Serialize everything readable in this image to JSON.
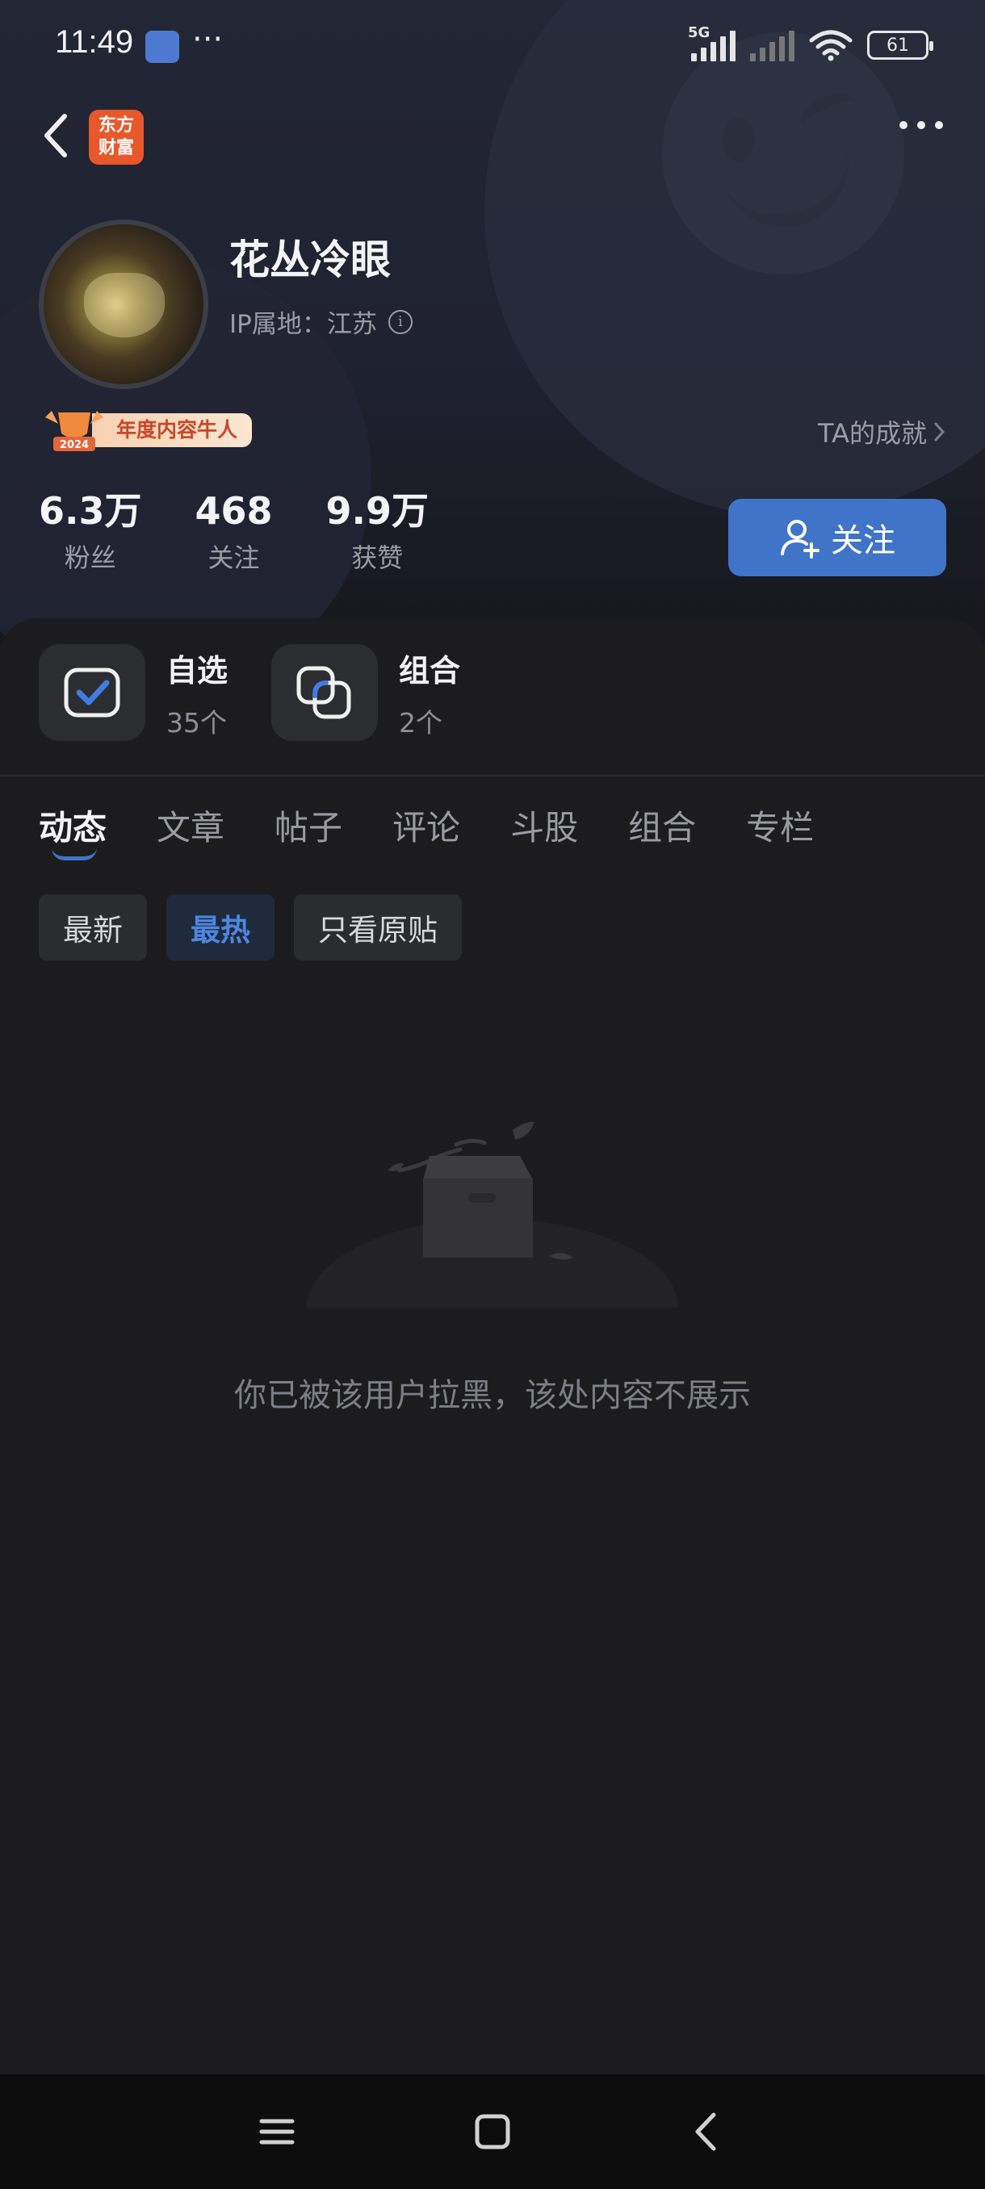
{
  "status_bar": {
    "time": "11:49",
    "more_dots": "···",
    "network": "5G",
    "battery": "61"
  },
  "nav": {
    "brand_logo_text": "东方财富",
    "brand_color": "#e8582a"
  },
  "profile": {
    "username": "花丛冷眼",
    "ip_location": "IP属地：江苏",
    "badge_year": "2024",
    "badge_label": "年度内容牛人",
    "achievements_link": "TA的成就"
  },
  "stats": [
    {
      "value": "6.3万",
      "label": "粉丝"
    },
    {
      "value": "468",
      "label": "关注"
    },
    {
      "value": "9.9万",
      "label": "获赞"
    }
  ],
  "follow_button": {
    "label": "关注",
    "color": "#3f74c9"
  },
  "quick_links": [
    {
      "title": "自选",
      "count": "35个",
      "icon": "checked-box-icon"
    },
    {
      "title": "组合",
      "count": "2个",
      "icon": "overlapping-squares-icon"
    }
  ],
  "tabs": [
    "动态",
    "文章",
    "帖子",
    "评论",
    "斗股",
    "组合",
    "专栏"
  ],
  "active_tab": "动态",
  "filters": [
    "最新",
    "最热",
    "只看原贴"
  ],
  "active_filter": "最热",
  "empty_state": {
    "message": "你已被该用户拉黑，该处内容不展示",
    "icon": "empty-box-icon"
  },
  "system_nav": [
    "menu-icon",
    "home-icon",
    "back-icon"
  ]
}
